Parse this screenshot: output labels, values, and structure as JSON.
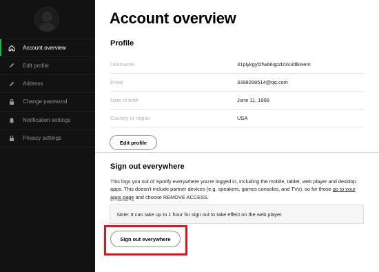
{
  "sidebar": {
    "items": [
      {
        "label": "Account overview",
        "icon": "home-icon",
        "active": true
      },
      {
        "label": "Edit profile",
        "icon": "pencil-icon",
        "active": false
      },
      {
        "label": "Address",
        "icon": "pencil-icon",
        "active": false
      },
      {
        "label": "Change password",
        "icon": "lock-icon",
        "active": false
      },
      {
        "label": "Notification settings",
        "icon": "bell-icon",
        "active": false
      },
      {
        "label": "Privacy settings",
        "icon": "lock-icon",
        "active": false
      }
    ]
  },
  "main": {
    "title": "Account overview",
    "profile": {
      "heading": "Profile",
      "rows": [
        {
          "label": "Username",
          "value": "31plykgyf2fw66qpzlz3v3dlkwem"
        },
        {
          "label": "Email",
          "value": "3398268514@qq.com"
        },
        {
          "label": "Date of birth",
          "value": "June 11, 1998"
        },
        {
          "label": "Country or region",
          "value": "USA"
        }
      ],
      "edit_button": "Edit profile"
    },
    "signout": {
      "heading": "Sign out everywhere",
      "description_before_link": "This logs you out of Spotify everywhere you're logged in, including the mobile, tablet, web player and desktop apps. This doesn't include partner devices (e.g. speakers, games consoles, and TVs), so for those ",
      "link_text": "go to your apps page",
      "description_after_link": " and choose REMOVE ACCESS.",
      "note": "Note: It can take up to 1 hour for sign out to take effect on the web player.",
      "button": "Sign out everywhere"
    }
  },
  "colors": {
    "sidebar_bg": "#121212",
    "accent": "#1db954",
    "highlight": "#e3111b"
  }
}
